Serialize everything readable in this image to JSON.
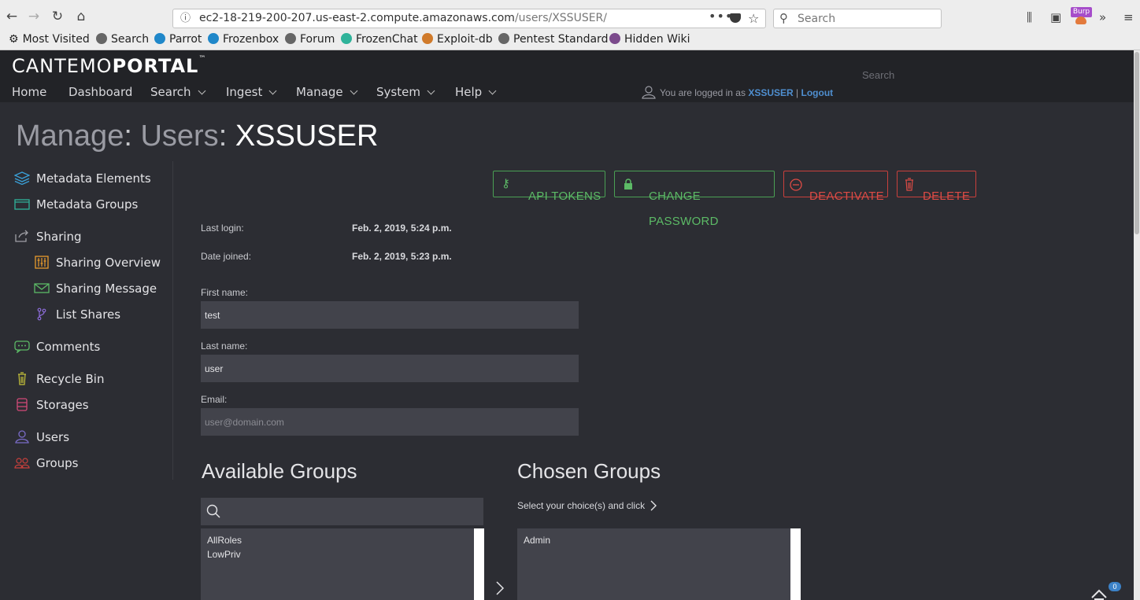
{
  "browser": {
    "url_host": "ec2-18-219-200-207.us-east-2.compute.amazonaws.com",
    "url_path": "/users/XSSUSER/",
    "search_placeholder": "Search",
    "burp_label": "Burp",
    "bookmarks": [
      "Most Visited",
      "Search",
      "Parrot",
      "Frozenbox",
      "Forum",
      "FrozenChat",
      "Exploit-db",
      "Pentest Standard",
      "Hidden Wiki"
    ]
  },
  "portal": {
    "logo_light": "CANTEMO",
    "logo_bold": "PORTAL",
    "logo_tm": "™",
    "search_placeholder": "Search",
    "nav": [
      "Home",
      "Dashboard",
      "Search",
      "Ingest",
      "Manage",
      "System",
      "Help"
    ],
    "login_prefix": "You are logged in as",
    "username": "XSSUSER",
    "login_sep": "|",
    "logout": "Logout"
  },
  "page": {
    "title_a": "Manage",
    "title_b": "Users",
    "title_c": "XSSUSER",
    "title_sep": ":"
  },
  "sidebar": [
    {
      "label": "Metadata Elements",
      "icon": "layers-icon",
      "color": "#3aa0d8"
    },
    {
      "label": "Metadata Groups",
      "icon": "folder-icon",
      "color": "#2fb39a"
    },
    {
      "label": "Sharing",
      "icon": "share-icon",
      "color": "#a0a0a6"
    },
    {
      "label": "Sharing Overview",
      "icon": "equalizer-icon",
      "color": "#e89a2c"
    },
    {
      "label": "Sharing Message",
      "icon": "envelope-icon",
      "color": "#5cba66"
    },
    {
      "label": "List Shares",
      "icon": "branch-icon",
      "color": "#8c6cd8"
    },
    {
      "label": "Comments",
      "icon": "comment-icon",
      "color": "#5cba66"
    },
    {
      "label": "Recycle Bin",
      "icon": "trash-icon",
      "color": "#c6c23a"
    },
    {
      "label": "Storages",
      "icon": "database-icon",
      "color": "#d24a78"
    },
    {
      "label": "Users",
      "icon": "user-icon",
      "color": "#7a6cc8"
    },
    {
      "label": "Groups",
      "icon": "group-icon",
      "color": "#c9403c"
    }
  ],
  "actions": {
    "api_tokens": "API TOKENS",
    "change_password": "CHANGE PASSWORD",
    "deactivate": "DEACTIVATE",
    "delete": "DELETE"
  },
  "details": {
    "last_login_label": "Last login:",
    "last_login_value": "Feb. 2, 2019, 5:24 p.m.",
    "date_joined_label": "Date joined:",
    "date_joined_value": "Feb. 2, 2019, 5:23 p.m."
  },
  "form": {
    "first_name_label": "First name:",
    "first_name_value": "test",
    "last_name_label": "Last name:",
    "last_name_value": "user",
    "email_label": "Email:",
    "email_placeholder": "user@domain.com"
  },
  "groups": {
    "available_title": "Available Groups",
    "chosen_title": "Chosen Groups",
    "choice_hint": "Select your choice(s) and click",
    "available": [
      "AllRoles",
      "LowPriv"
    ],
    "chosen": [
      "Admin"
    ],
    "notification_count": "0"
  }
}
